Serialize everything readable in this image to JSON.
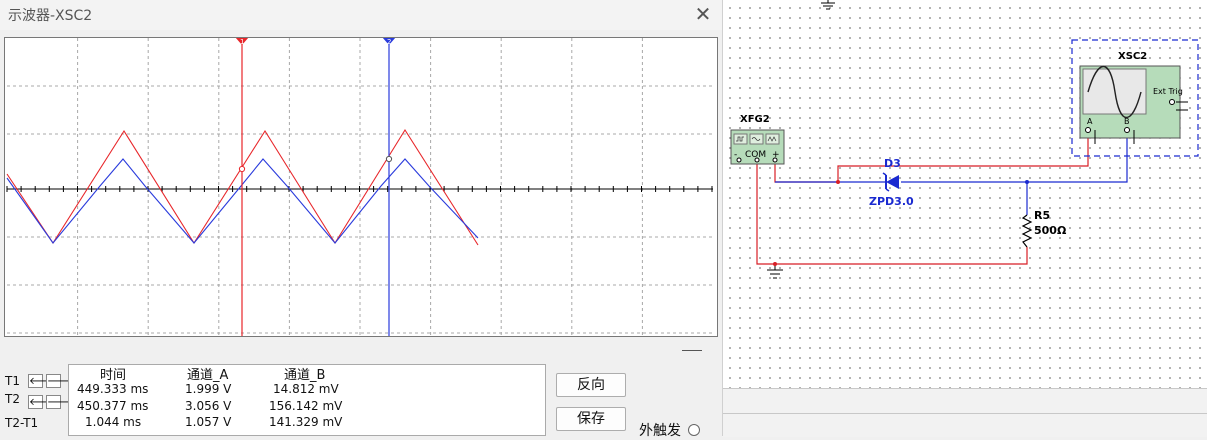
{
  "window": {
    "title": "示波器-XSC2",
    "close_glyph": "✕"
  },
  "readout": {
    "columns": [
      "时间",
      "通道_A",
      "通道_B"
    ],
    "rows": [
      {
        "label": "T1",
        "time": "449.333 ms",
        "ch_a": "1.999 V",
        "ch_b": "14.812 mV"
      },
      {
        "label": "T2",
        "time": "450.377 ms",
        "ch_a": "3.056 V",
        "ch_b": "156.142 mV"
      },
      {
        "label": "T2-T1",
        "time": "1.044 ms",
        "ch_a": "1.057 V",
        "ch_b": "141.329 mV"
      }
    ],
    "left_arrow": "🡐",
    "right_arrow": "🡒"
  },
  "buttons": {
    "reverse": "反向",
    "save": "保存"
  },
  "trigger": {
    "ext_label": "外触发"
  },
  "cursors": {
    "t1_marker": "1",
    "t2_marker": "2"
  },
  "schematic": {
    "function_generator": {
      "name": "XFG2",
      "terminals": [
        "-",
        "COM",
        "+"
      ]
    },
    "oscilloscope": {
      "name": "XSC2",
      "ext_trig": "Ext Trig",
      "channel_a": "A",
      "channel_b": "B"
    },
    "diode": {
      "ref": "D3",
      "value": "ZPD3.0"
    },
    "resistor": {
      "ref": "R5",
      "value": "500Ω"
    }
  },
  "colors": {
    "channel_a": "#e8262a",
    "channel_b": "#2a3bdc",
    "cursor_t1": "#e8262a",
    "cursor_t2": "#2a3bdc",
    "wire_red": "#d81f26",
    "wire_blue": "#1a2ad0"
  }
}
